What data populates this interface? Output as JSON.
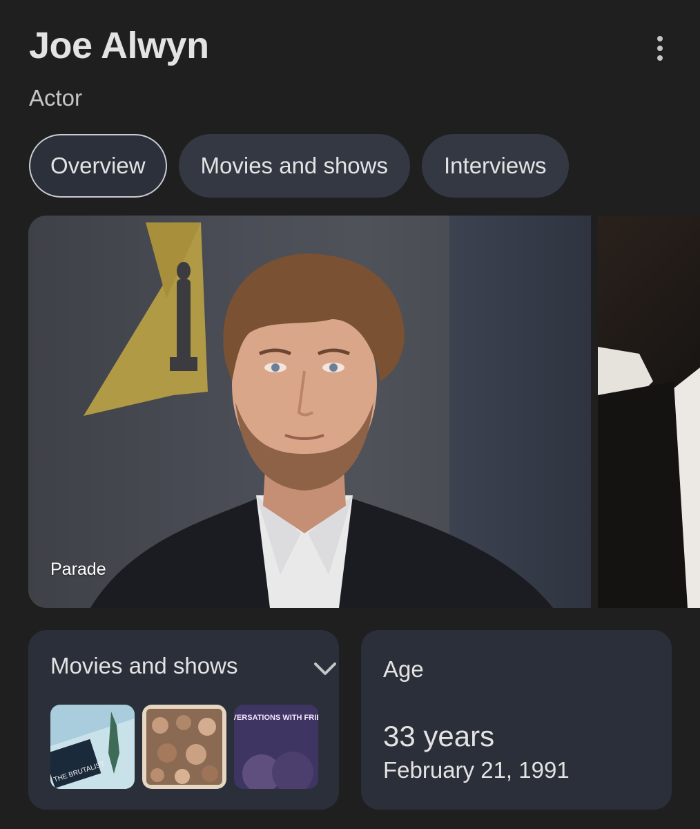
{
  "header": {
    "title": "Joe Alwyn",
    "subtitle": "Actor",
    "more_icon": "more-vert-icon"
  },
  "tabs": [
    {
      "label": "Overview",
      "active": true
    },
    {
      "label": "Movies and shows",
      "active": false
    },
    {
      "label": "Interviews",
      "active": false
    }
  ],
  "images": {
    "main_caption": "Parade"
  },
  "movies_card": {
    "title": "Movies and shows",
    "expand_icon": "chevron-down-icon",
    "thumbnails": [
      {
        "text": "THE BRUTALIST"
      },
      {
        "text": ""
      },
      {
        "text": "CONVERSATIONS WITH FRIENDS"
      }
    ]
  },
  "age_card": {
    "title": "Age",
    "value": "33 years",
    "date": "February 21, 1991"
  },
  "colors": {
    "background": "#1f1f1f",
    "chip": "#333842",
    "card": "#2b2f3a",
    "text": "#e3e3e3"
  }
}
